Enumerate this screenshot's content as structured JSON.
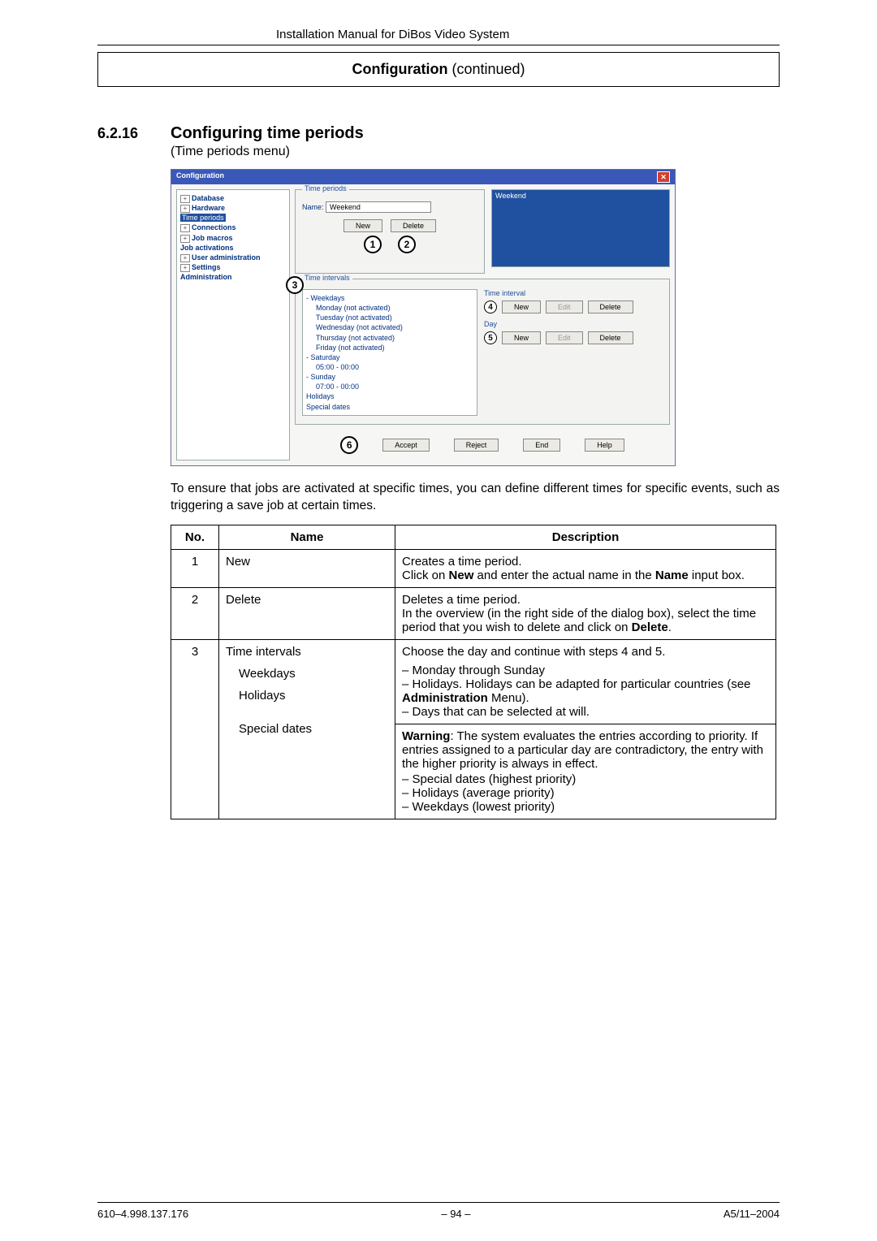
{
  "header": {
    "doc_title": "Installation Manual for DiBos Video System",
    "section_box_bold": "Configuration",
    "section_box_rest": "  (continued)"
  },
  "section": {
    "number": "6.2.16",
    "title": "Configuring time periods",
    "subtitle": "(Time periods menu)"
  },
  "screenshot": {
    "window_title": "Configuration",
    "close": "✕",
    "tree": {
      "items": [
        "Database",
        "Hardware",
        "Time periods",
        "Connections",
        "Job macros",
        "Job activations",
        "User administration",
        "Settings",
        "Administration"
      ],
      "selected_index": 2,
      "expandable_indexes": [
        0,
        1,
        3,
        4,
        6,
        7
      ]
    },
    "time_periods": {
      "legend": "Time periods",
      "name_label": "Name:",
      "name_value": "Weekend",
      "btn_new": "New",
      "btn_delete": "Delete"
    },
    "intervals": {
      "legend": "Time intervals",
      "tree": [
        {
          "label": "Weekdays",
          "level": 0,
          "exp": "-"
        },
        {
          "label": "Monday (not activated)",
          "level": 1
        },
        {
          "label": "Tuesday (not activated)",
          "level": 1
        },
        {
          "label": "Wednesday (not activated)",
          "level": 1
        },
        {
          "label": "Thursday (not activated)",
          "level": 1
        },
        {
          "label": "Friday (not activated)",
          "level": 1
        },
        {
          "label": "Saturday",
          "level": 0,
          "exp": "-"
        },
        {
          "label": "05:00 - 00:00",
          "level": 1
        },
        {
          "label": "Sunday",
          "level": 0,
          "exp": "-"
        },
        {
          "label": "07:00 - 00:00",
          "level": 1
        },
        {
          "label": "Holidays",
          "level": 0
        },
        {
          "label": "Special dates",
          "level": 0
        }
      ],
      "side": {
        "listbox_item": "Weekend",
        "group_time": "Time interval",
        "group_day": "Day",
        "btn_new": "New",
        "btn_edit": "Edit",
        "btn_delete": "Delete"
      }
    },
    "bottom": {
      "accept": "Accept",
      "reject": "Reject",
      "end": "End",
      "help": "Help"
    },
    "callouts": {
      "c1": "1",
      "c2": "2",
      "c3": "3",
      "c4": "4",
      "c5": "5",
      "c6": "6"
    }
  },
  "paragraph": "To ensure that jobs are activated at specific times, you can define different times for specific events, such as triggering a save job at certain times.",
  "table": {
    "headers": {
      "no": "No.",
      "name": "Name",
      "desc": "Description"
    },
    "rows": [
      {
        "no": "1",
        "name": "New",
        "desc_pre": "Creates a time period.",
        "desc_mid_a": "Click on ",
        "desc_mid_bold": "New",
        "desc_mid_b": " and enter the actual name in the ",
        "desc_mid_bold2": "Name",
        "desc_mid_c": " input box."
      },
      {
        "no": "2",
        "name": "Delete",
        "desc_pre": "Deletes a time period.",
        "desc_line2": "In the overview (in the right side of the dialog box), select the time period that you wish to delete and click on ",
        "desc_bold": "Delete",
        "desc_tail": "."
      }
    ],
    "row3": {
      "no": "3",
      "name_top": "Time intervals",
      "name_sub": [
        "Weekdays",
        "Holidays",
        "Special dates"
      ],
      "desc_top": "Choose the day and continue with steps 4 and 5.",
      "desc_sub": [
        "Monday through Sunday",
        "Holidays. Holidays can be adapted for particular countries (see Administration Menu).",
        "Days that can be selected at will."
      ],
      "admin_bold": "Administration",
      "warning_label": "Warning",
      "warning_body": ": The system evaluates the entries according to priority. If entries assigned to a particular day are contradictory, the entry with the higher priority is always in effect.",
      "warning_list": [
        "Special dates (highest priority)",
        "Holidays (average priority)",
        "Weekdays (lowest priority)"
      ]
    }
  },
  "footer": {
    "left": "610–4.998.137.176",
    "center": "–  94  –",
    "right": "A5/11–2004"
  }
}
